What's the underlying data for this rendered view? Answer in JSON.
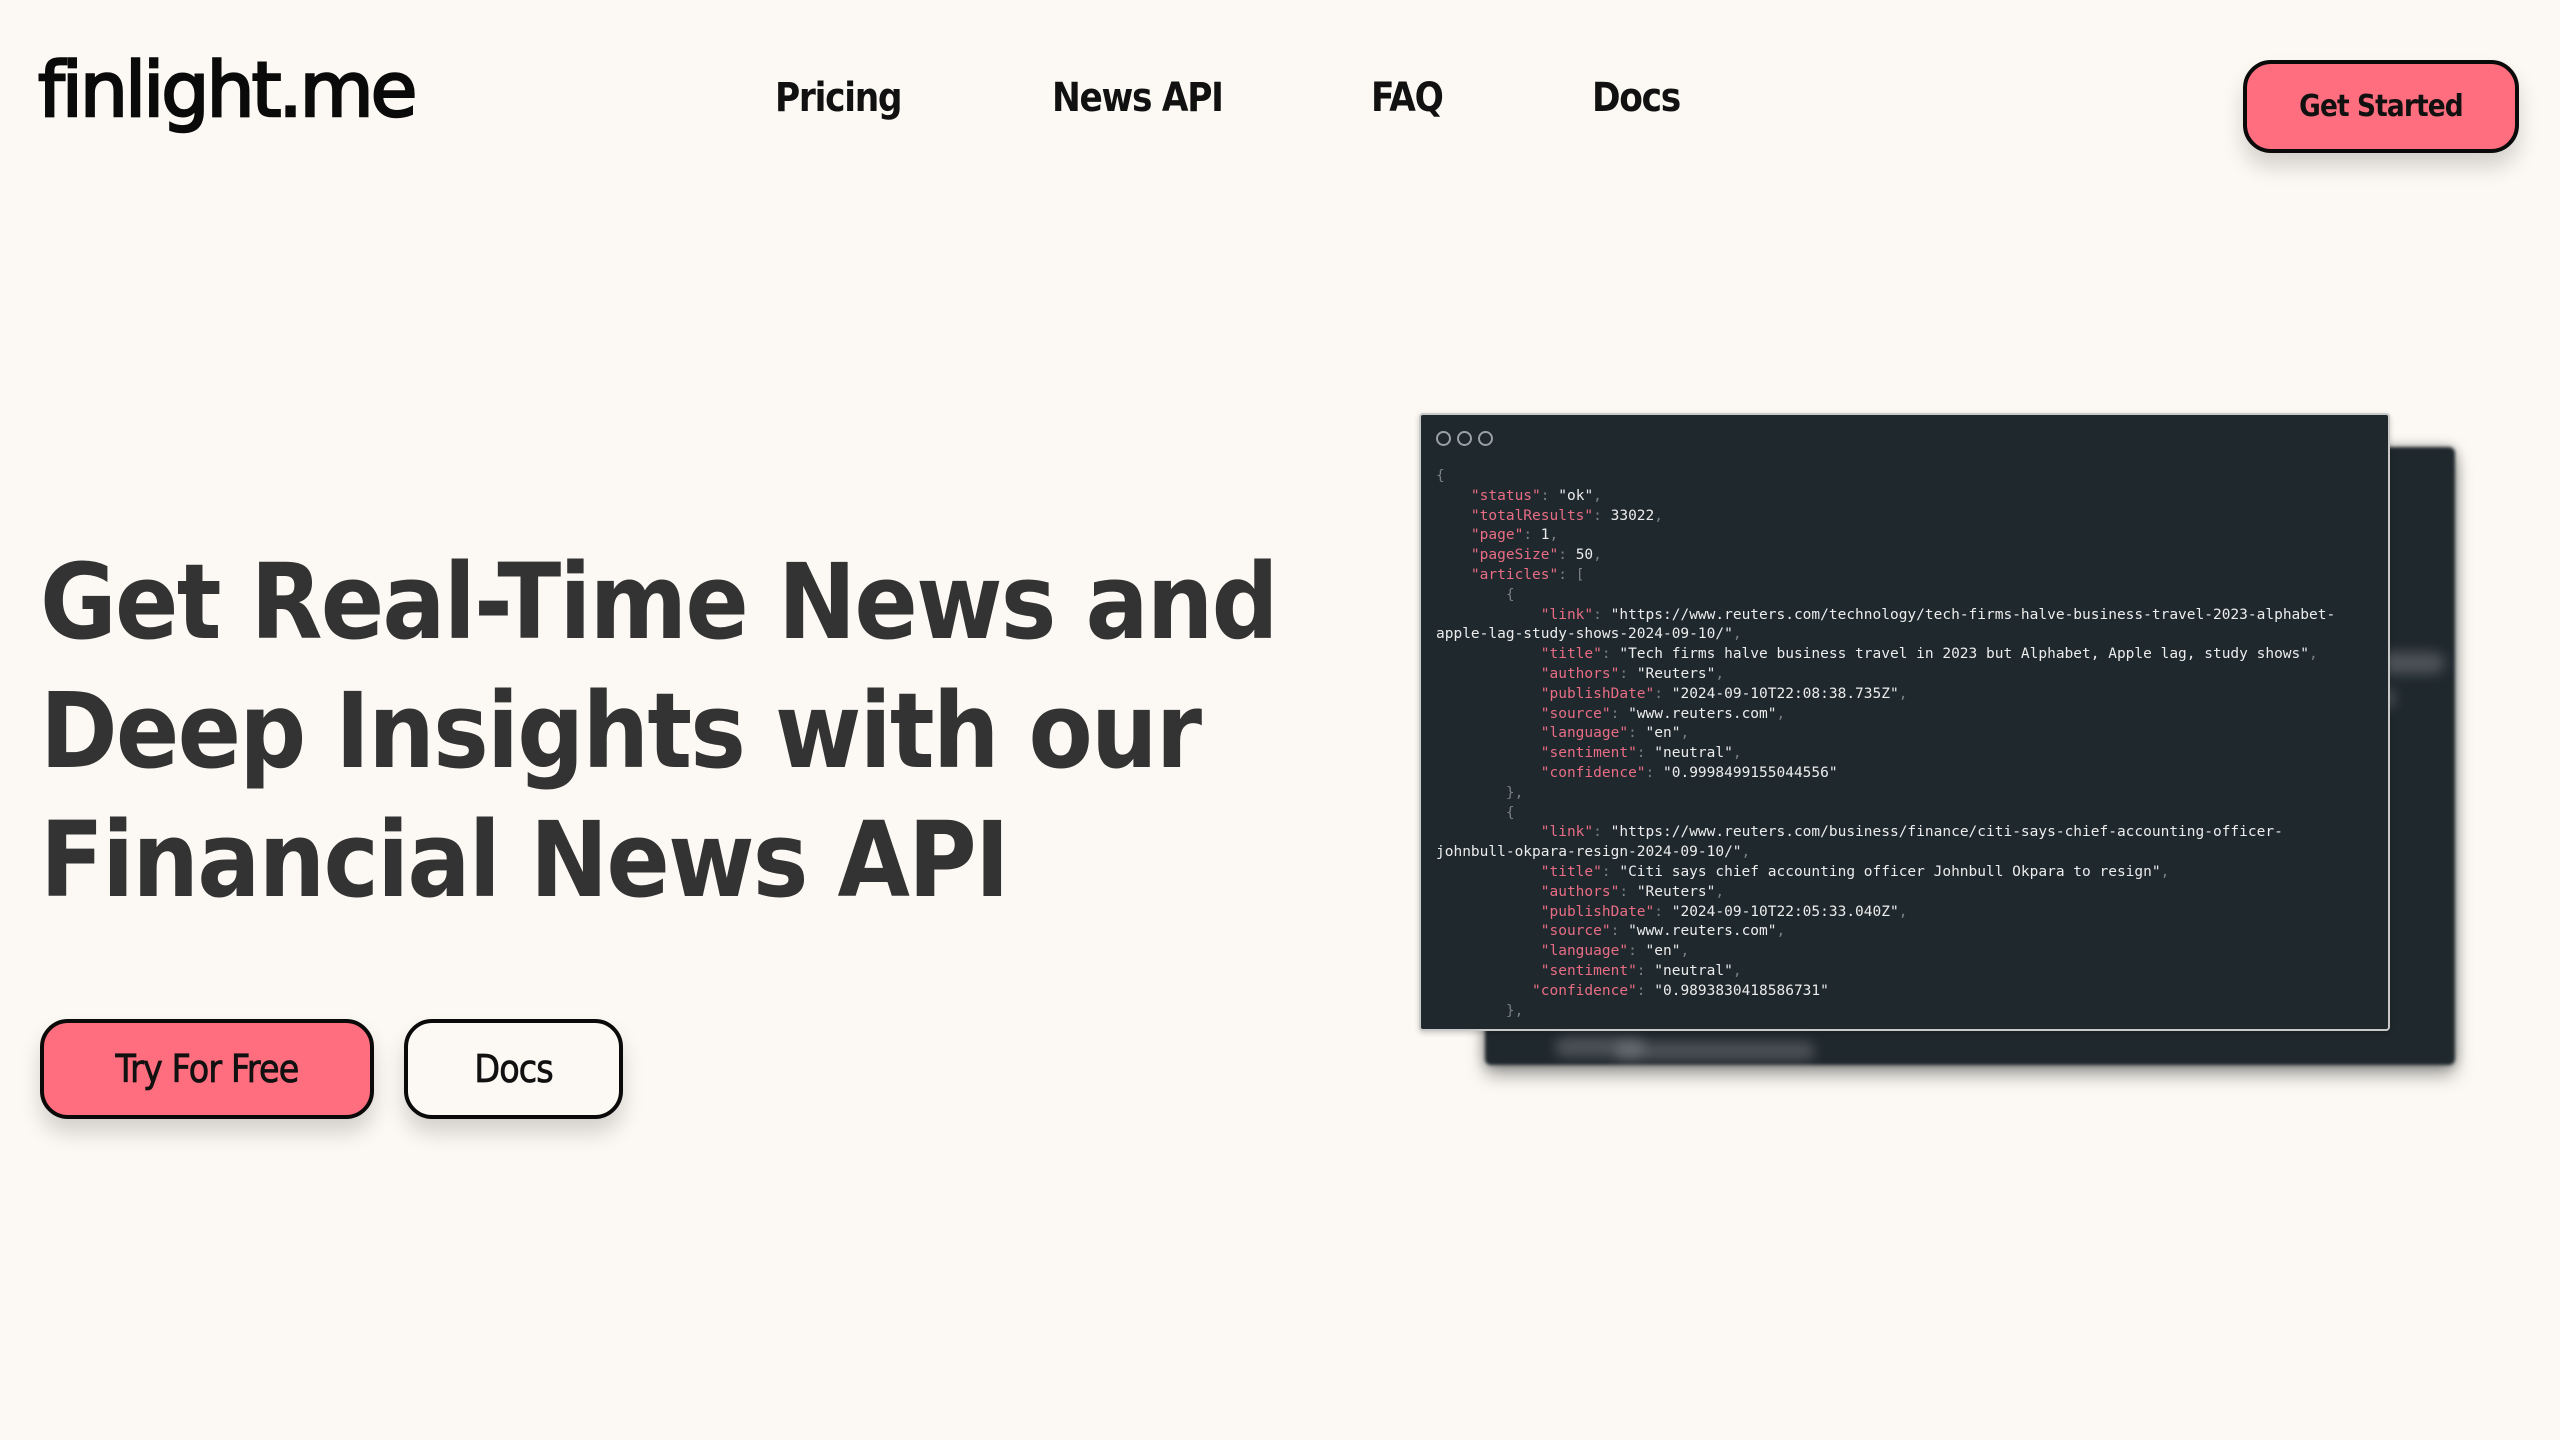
{
  "header": {
    "logo": "finlight.me",
    "nav": [
      {
        "label": "Pricing"
      },
      {
        "label": "News API"
      },
      {
        "label": "FAQ"
      },
      {
        "label": "Docs"
      }
    ],
    "cta_label": "Get Started"
  },
  "hero": {
    "title_lines": [
      "Get Real-Time News and",
      "Deep Insights with our",
      "Financial News API"
    ],
    "primary_button": "Try For Free",
    "secondary_button": "Docs"
  },
  "colors": {
    "background": "#fcf9f4",
    "accent": "#ff6e7e",
    "code_bg": "#1f282d",
    "code_key": "#e86d84",
    "heading": "#333333"
  },
  "code_sample": {
    "window_icons": [
      "circle-icon",
      "circle-icon",
      "circle-icon"
    ],
    "status": "ok",
    "totalResults": "33022",
    "page": "1",
    "pageSize": "50",
    "articles": [
      {
        "link_line1": "\"https://www.reuters.com/technology/tech-firms-halve-business-travel-2023-alphabet-",
        "link_line2": "apple-lag-study-shows-2024-09-10/\"",
        "title": "\"Tech firms halve business travel in 2023 but Alphabet, Apple lag, study shows\"",
        "authors": "\"Reuters\"",
        "publishDate": "\"2024-09-10T22:08:38.735Z\"",
        "source": "\"www.reuters.com\"",
        "language": "\"en\"",
        "sentiment": "\"neutral\"",
        "confidence": "\"0.9998499155044556\""
      },
      {
        "link_line1": "\"https://www.reuters.com/business/finance/citi-says-chief-accounting-officer-",
        "link_line2": "johnbull-okpara-resign-2024-09-10/\"",
        "title": "\"Citi says chief accounting officer Johnbull Okpara to resign\"",
        "authors": "\"Reuters\"",
        "publishDate": "\"2024-09-10T22:05:33.040Z\"",
        "source": "\"www.reuters.com\"",
        "language": "\"en\"",
        "sentiment": "\"neutral\"",
        "confidence": "\"0.9893830418586731\""
      }
    ]
  }
}
